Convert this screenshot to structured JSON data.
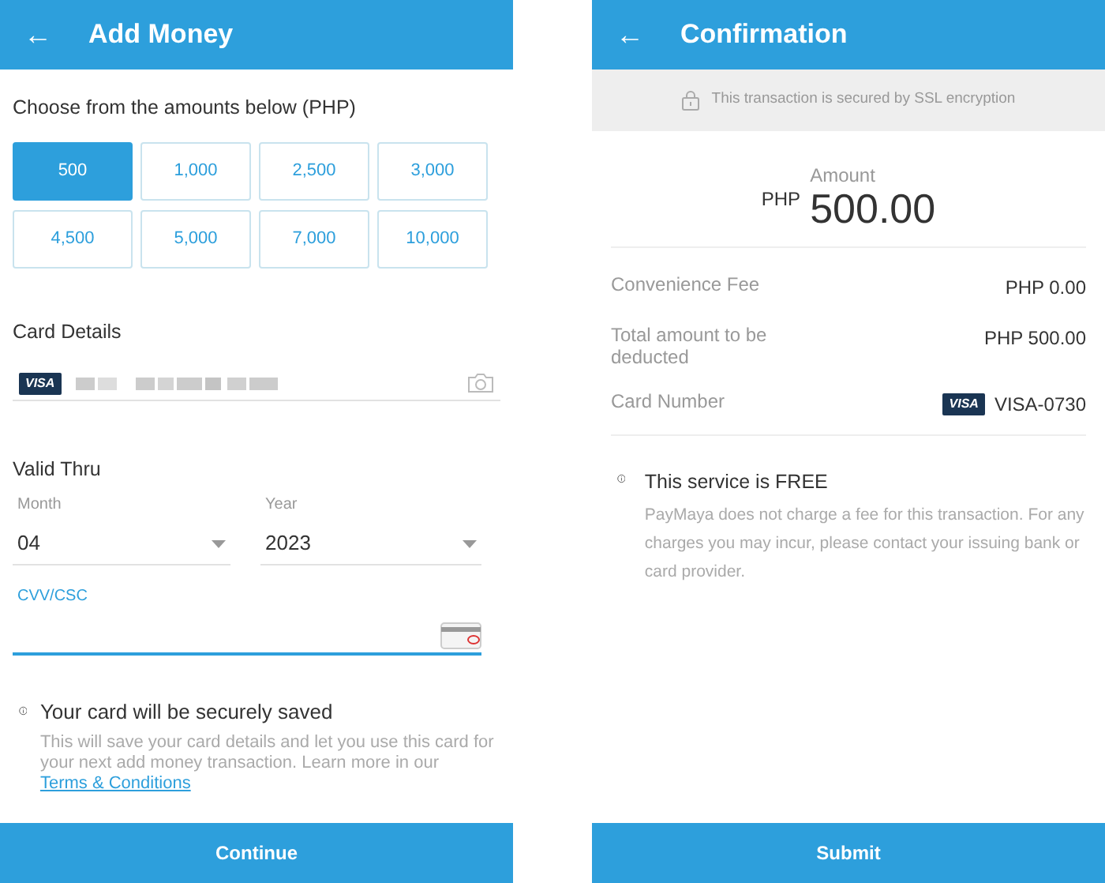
{
  "add_money": {
    "header": {
      "back": "←",
      "title": "Add Money"
    },
    "amounts_title": "Choose from the amounts below (PHP)",
    "amounts": [
      {
        "label": "500",
        "selected": true
      },
      {
        "label": "1,000",
        "selected": false
      },
      {
        "label": "2,500",
        "selected": false
      },
      {
        "label": "3,000",
        "selected": false
      },
      {
        "label": "4,500",
        "selected": false
      },
      {
        "label": "5,000",
        "selected": false
      },
      {
        "label": "7,000",
        "selected": false
      },
      {
        "label": "10,000",
        "selected": false
      }
    ],
    "card_details": {
      "title": "Card Details",
      "brand": "VISA"
    },
    "valid_thru": {
      "title": "Valid Thru",
      "month": {
        "label": "Month",
        "value": "04"
      },
      "year": {
        "label": "Year",
        "value": "2023"
      }
    },
    "cvv": {
      "label": "CVV/CSC",
      "focused": true
    },
    "notice": {
      "title": "Your card will be securely saved",
      "text": "This will save your card details and let you use this card for your next add money transaction. Learn more in our",
      "link": "Terms & Conditions"
    },
    "button": "Continue"
  },
  "confirmation": {
    "header": {
      "back": "←",
      "title": "Confirmation"
    },
    "secure_banner": "This transaction is secured by SSL encryption",
    "amount": {
      "label": "Amount",
      "currency": "PHP",
      "value": "500.00"
    },
    "rows": [
      {
        "label": "Convenience Fee",
        "value": "PHP 0.00"
      },
      {
        "label": "Total amount to be deducted",
        "value": "PHP 500.00"
      },
      {
        "label": "Card Number",
        "brand": "VISA",
        "value": "VISA-0730"
      }
    ],
    "notice": {
      "title": "This service is FREE",
      "text": "PayMaya does not charge a fee for this transaction. For any charges you may incur, please contact your issuing bank or card provider."
    },
    "button": "Submit"
  }
}
